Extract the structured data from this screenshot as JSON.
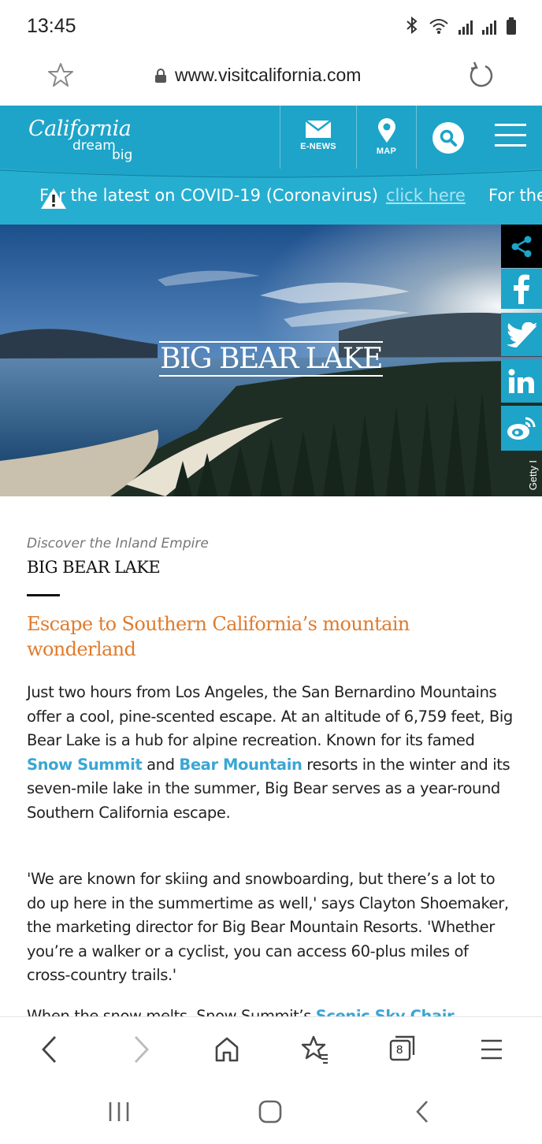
{
  "status_bar": {
    "time": "13:45",
    "icons": [
      "bluetooth-icon",
      "wifi-icon",
      "signal-icon",
      "signal-icon",
      "battery-icon"
    ]
  },
  "browser": {
    "url": "www.visitcalifornia.com",
    "icons": [
      "star-icon",
      "lock-icon",
      "reload-icon"
    ]
  },
  "site_header": {
    "logo": {
      "line1": "California",
      "line2": "dream",
      "line3": "big"
    },
    "nav": {
      "enews_label": "E-NEWS",
      "map_label": "MAP"
    },
    "colors": {
      "header_bg": "#1ea4c8",
      "alert_bg": "#26aed0"
    }
  },
  "alert": {
    "text": "For the latest on COVID-19 (Coronavirus)",
    "link": "click here",
    "repeat_text": "For the"
  },
  "hero": {
    "title": "BIG BEAR LAKE",
    "credit": "Getty I"
  },
  "article": {
    "kicker": "Discover the Inland Empire",
    "title": "BIG BEAR LAKE",
    "subhead": "Escape to Southern California’s mountain wonderland",
    "p1_a": "Just two hours from Los Angeles, the San Bernardino Mountains offer a cool, pine-scented escape. At an altitude of 6,759 feet, Big Bear Lake is a hub for alpine recreation. Known for its famed ",
    "p1_link1": "Snow Summit",
    "p1_b": " and ",
    "p1_link2": "Bear Mountain",
    "p1_c": " resorts in the winter and its seven-mile lake in the summer, Big Bear serves as a year-round Southern California escape.",
    "p2": "'We are known for skiing and snowboarding, but there’s a lot to do up here in the summertime as well,' says Clayton Shoemaker, the marketing director for Big Bear Mountain Resorts. 'Whether you’re a walker or a cyclist, you can access 60-plus miles of cross-country trails.'",
    "p3_a": "When the snow melts, Snow Summit’s ",
    "p3_link": "Scenic Sky Chair"
  },
  "bottom_toolbar": {
    "tabs_count": "8",
    "icons": [
      "back-icon",
      "forward-icon",
      "home-icon",
      "bookmarks-icon",
      "tabs-icon",
      "menu-icon"
    ]
  },
  "system_nav": {
    "icons": [
      "recents-icon",
      "home-icon",
      "back-icon"
    ]
  }
}
